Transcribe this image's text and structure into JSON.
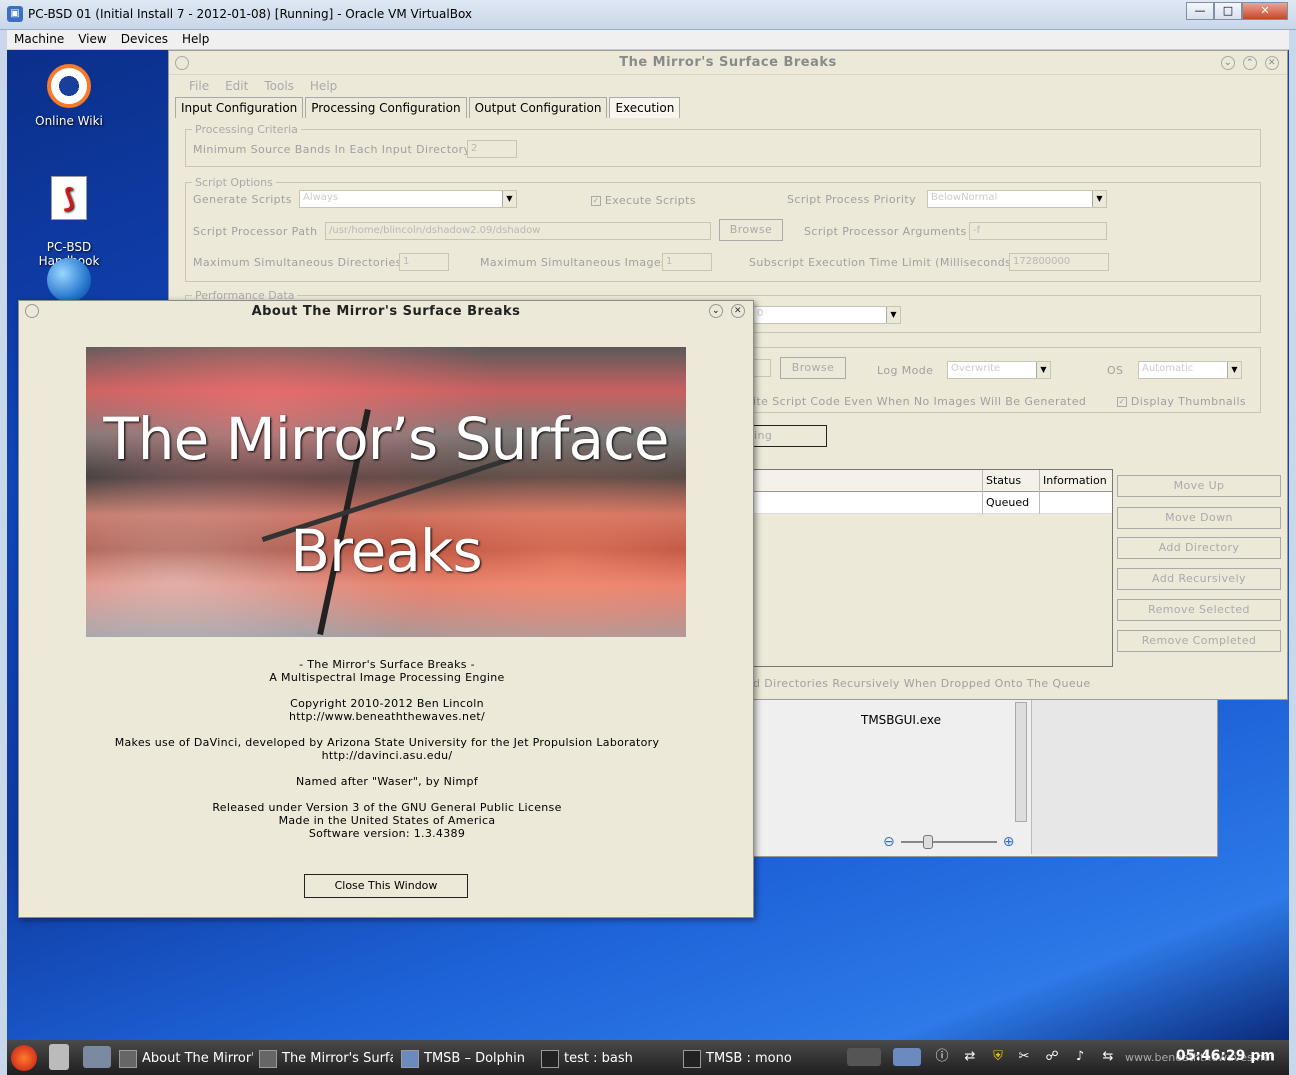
{
  "vbox": {
    "title": "PC-BSD 01 (Initial Install 7 - 2012-01-08) [Running] - Oracle VM VirtualBox",
    "menu": [
      "Machine",
      "View",
      "Devices",
      "Help"
    ]
  },
  "desktop": {
    "icons": [
      {
        "label": "Online Wiki"
      },
      {
        "label": "PC-BSD\nHandbook"
      }
    ]
  },
  "dolphin": {
    "file_name": "TMSBGUI.exe"
  },
  "main": {
    "title": "The Mirror's Surface Breaks",
    "menu": [
      "File",
      "Edit",
      "Tools",
      "Help"
    ],
    "tabs": [
      "Input Configuration",
      "Processing Configuration",
      "Output Configuration",
      "Execution"
    ],
    "selected_tab": "Execution",
    "processing_criteria": {
      "legend": "Processing Criteria",
      "min_bands_label": "Minimum Source Bands In Each Input Directory",
      "min_bands_value": "2"
    },
    "script_options": {
      "legend": "Script Options",
      "generate_label": "Generate Scripts",
      "generate_value": "Always",
      "execute_label": "Execute Scripts",
      "priority_label": "Script Process Priority",
      "priority_value": "BelowNormal",
      "path_label": "Script Processor Path",
      "path_value": "/usr/home/blincoln/dshadow2.09/dshadow",
      "browse": "Browse",
      "args_label": "Script Processor Arguments",
      "args_value": "-f",
      "max_dirs_label": "Maximum Simultaneous Directories",
      "max_dirs_value": "1",
      "max_images_label": "Maximum Simultaneous Images",
      "max_images_value": "1",
      "timeout_label": "Subscript Execution Time Limit (Milliseconds)",
      "timeout_value": "172800000"
    },
    "performance": {
      "legend": "Performance Data",
      "combo_value": "0"
    },
    "log": {
      "browse": "Browse",
      "mode_label": "Log Mode",
      "mode_value": "Overwrite",
      "os_label": "OS",
      "os_value": "Automatic",
      "write_code_label": "ite Script Code Even When No Images Will Be Generated",
      "thumbs_label": "Display Thumbnails",
      "start_button": "ing"
    },
    "queue": {
      "columns": [
        "Status",
        "Information"
      ],
      "rows": [
        {
          "status": "Queued",
          "information": ""
        }
      ],
      "buttons": [
        "Move Up",
        "Move Down",
        "Add Directory",
        "Add Recursively",
        "Remove Selected",
        "Remove Completed"
      ],
      "recursive_label": "d Directories Recursively When Dropped Onto The Queue"
    }
  },
  "about": {
    "title": "About The Mirror's Surface Breaks",
    "banner_line1": "The Mirror’s Surface",
    "banner_line2": "Breaks",
    "lines": [
      "- The Mirror's Surface Breaks -",
      "A Multispectral Image Processing Engine",
      "Copyright 2010-2012 Ben Lincoln",
      "http://www.beneaththewaves.net/",
      "Makes use of DaVinci, developed by Arizona State University for the Jet Propulsion Laboratory",
      "http://davinci.asu.edu/",
      "Named after \"Waser\", by Nimpf",
      "Released under Version 3 of the GNU General Public License",
      "Made in the United States of America",
      "Software version: 1.3.4389"
    ],
    "close_button": "Close This Window"
  },
  "taskbar": {
    "tasks": [
      "About The Mirror's",
      "The Mirror's Surfa",
      "TMSB – Dolphin",
      "test : bash",
      "TMSB : mono"
    ],
    "clock": "05:46:29 pm",
    "watermark": "www.beneaththewaves.net"
  },
  "colors": {
    "window_bg": "#ece9d8",
    "desktop_blue": "#1145b8",
    "disabled_text": "#a0a0a0"
  }
}
